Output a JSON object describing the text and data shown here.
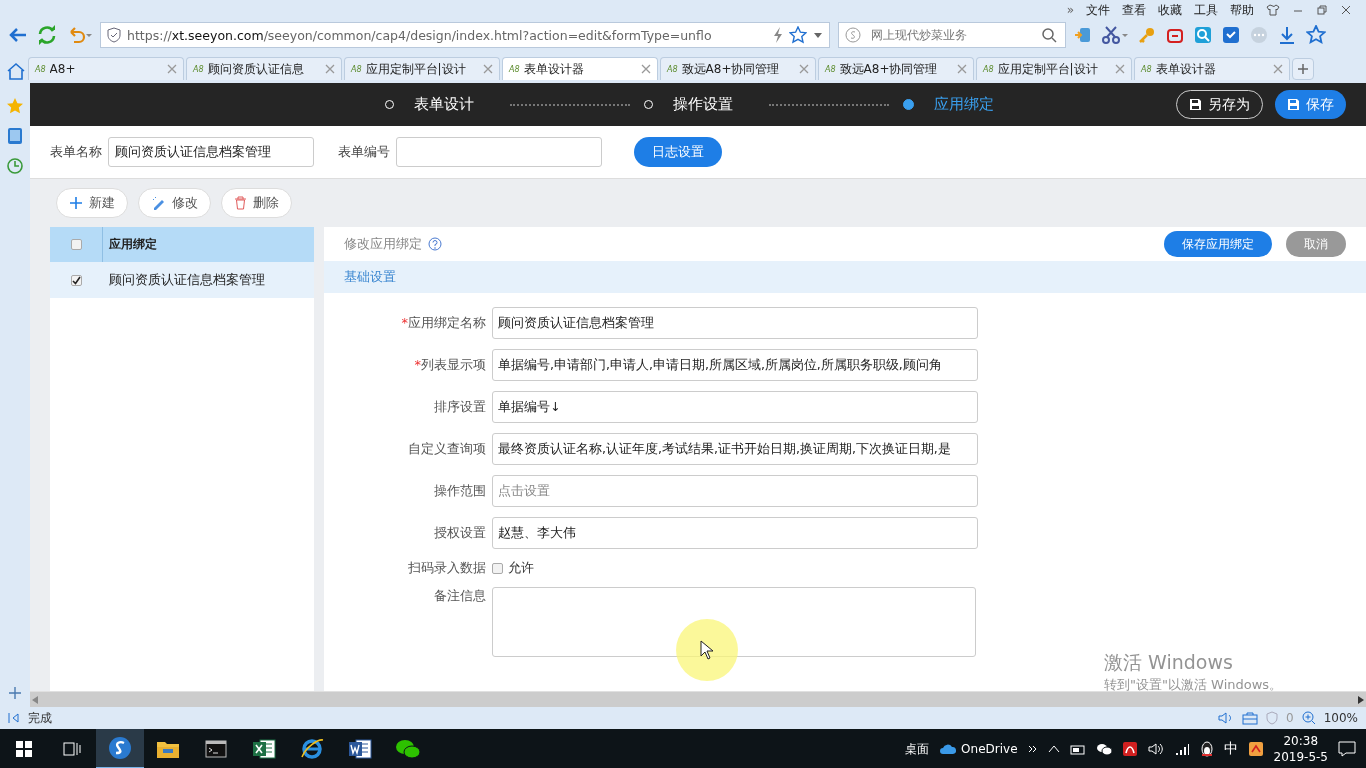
{
  "browser": {
    "more": "»",
    "menu": [
      "文件",
      "查看",
      "收藏",
      "工具",
      "帮助"
    ],
    "address": {
      "scheme": "https://",
      "host": "xt.seeyon.com",
      "path": "/seeyon/common/cap4/design/index.html?action=edit&formType=unflo"
    },
    "search": {
      "placeholder": "网上现代炒菜业务"
    },
    "tabs": [
      {
        "logo": "A8",
        "label": "A8+",
        "selected": false
      },
      {
        "logo": "A8",
        "label": "顾问资质认证信息",
        "selected": false
      },
      {
        "logo": "A8",
        "label": "应用定制平台|设计",
        "selected": false
      },
      {
        "logo": "A8",
        "label": "表单设计器",
        "selected": true
      },
      {
        "logo": "A8",
        "label": "致远A8+协同管理",
        "selected": false
      },
      {
        "logo": "A8",
        "label": "致远A8+协同管理",
        "selected": false
      },
      {
        "logo": "A8",
        "label": "应用定制平台|设计",
        "selected": false
      },
      {
        "logo": "A8",
        "label": "表单设计器",
        "selected": false
      }
    ]
  },
  "header": {
    "steps": [
      {
        "label": "表单设计",
        "selected": false
      },
      {
        "label": "操作设置",
        "selected": false
      },
      {
        "label": "应用绑定",
        "selected": true
      }
    ],
    "buttons": [
      {
        "label": "另存为",
        "kind": "outline"
      },
      {
        "label": "保存",
        "kind": "primary"
      }
    ]
  },
  "form_info": {
    "name_label": "表单名称",
    "name_value": "顾问资质认证信息档案管理",
    "number_label": "表单编号",
    "log_button": "日志设置"
  },
  "toolbar": [
    {
      "label": "新建",
      "kind": "add"
    },
    {
      "label": "修改",
      "kind": "edit"
    },
    {
      "label": "删除",
      "kind": "delete"
    }
  ],
  "list": {
    "header": "应用绑定",
    "header_checked": false,
    "rows": [
      {
        "label": "顾问资质认证信息档案管理",
        "checked": true,
        "selected": true
      }
    ]
  },
  "detail": {
    "title": "修改应用绑定",
    "buttons": [
      {
        "label": "保存应用绑定",
        "kind": "primary"
      },
      {
        "label": "取消",
        "kind": "grey"
      }
    ],
    "section": "基础设置",
    "required_mark": "*",
    "fields": [
      {
        "label": "应用绑定名称",
        "required": true,
        "kind": "text",
        "value": "顾问资质认证信息档案管理"
      },
      {
        "label": "列表显示项",
        "required": true,
        "kind": "text",
        "value": "单据编号,申请部门,申请人,申请日期,所属区域,所属岗位,所属职务职级,顾问角"
      },
      {
        "label": "排序设置",
        "required": false,
        "kind": "text",
        "value": "单据编号↓"
      },
      {
        "label": "自定义查询项",
        "required": false,
        "kind": "text",
        "value": "最终资质认证名称,认证年度,考试结果,证书开始日期,换证周期,下次换证日期,是"
      },
      {
        "label": "操作范围",
        "required": false,
        "kind": "text",
        "placeholder": "点击设置"
      },
      {
        "label": "授权设置",
        "required": false,
        "kind": "text",
        "value": "赵慧、李大伟"
      },
      {
        "label": "扫码录入数据",
        "required": false,
        "kind": "checkbox",
        "option": "允许",
        "checked": false
      },
      {
        "label": "备注信息",
        "required": false,
        "kind": "textarea"
      }
    ]
  },
  "status_bar": {
    "text": "完成",
    "count": "0",
    "zoom": "100%"
  },
  "watermark": {
    "title": "激活 Windows",
    "subtitle": "转到\"设置\"以激活 Windows。"
  },
  "taskbar": {
    "desktop": "桌面",
    "onedrive": "OneDrive",
    "ime": "中",
    "time": "20:38",
    "date": "2019-5-5"
  }
}
